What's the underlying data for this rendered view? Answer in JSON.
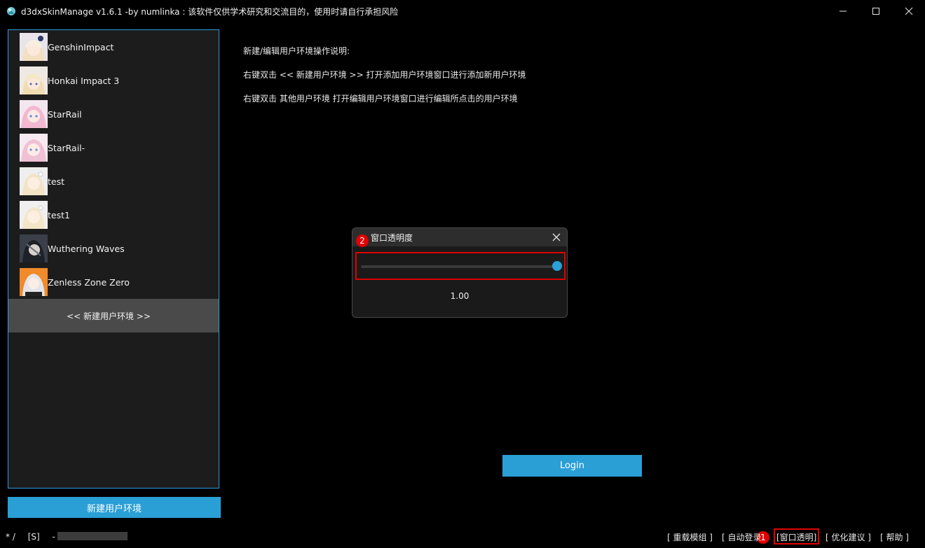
{
  "window": {
    "title": "d3dxSkinManage v1.6.1 -by numlinka : 该软件仅供学术研究和交流目的，使用时请自行承担风险",
    "controls": [
      "minimize",
      "maximize",
      "close"
    ]
  },
  "sidebar": {
    "items": [
      {
        "label": "GenshinImpact",
        "icon": "genshin-avatar"
      },
      {
        "label": "Honkai Impact 3",
        "icon": "honkai-avatar"
      },
      {
        "label": "StarRail",
        "icon": "starrail-avatar"
      },
      {
        "label": "StarRail-",
        "icon": "starrail-avatar-2"
      },
      {
        "label": "test",
        "icon": "test-avatar"
      },
      {
        "label": "test1",
        "icon": "test1-avatar"
      },
      {
        "label": "Wuthering Waves",
        "icon": "wuthering-avatar"
      },
      {
        "label": "Zenless Zone Zero",
        "icon": "zzz-avatar"
      }
    ],
    "new_env_item": "<< 新建用户环境 >>",
    "accent": "#2e9be0"
  },
  "new_env_button": "新建用户环境",
  "instructions": {
    "line1": "新建/编辑用户环境操作说明:",
    "line2": "右键双击 << 新建用户环境 >> 打开添加用户环境窗口进行添加新用户环境",
    "line3": "右键双击 其他用户环境 打开编辑用户环境窗口进行编辑所点击的用户环境"
  },
  "login_button": "Login",
  "opacity_dialog": {
    "title": "窗口透明度",
    "value": 1.0,
    "value_text": "1.00",
    "slider_min": 0,
    "slider_max": 1
  },
  "annotations": {
    "badge1": "1",
    "badge2": "2",
    "color": "#e00000"
  },
  "status": {
    "left1": "* /",
    "left2": "[S]",
    "left3": "-"
  },
  "footer": {
    "reload": "[ 重载模组 ]",
    "auto_login": "[ 自动登录",
    "window_opacity": "[窗口透明]",
    "suggest": "[ 优化建议 ]",
    "help": "[ 帮助 ]"
  },
  "colors": {
    "primary": "#2a9fd6",
    "background": "#000000",
    "panel": "#1c1c1c"
  }
}
